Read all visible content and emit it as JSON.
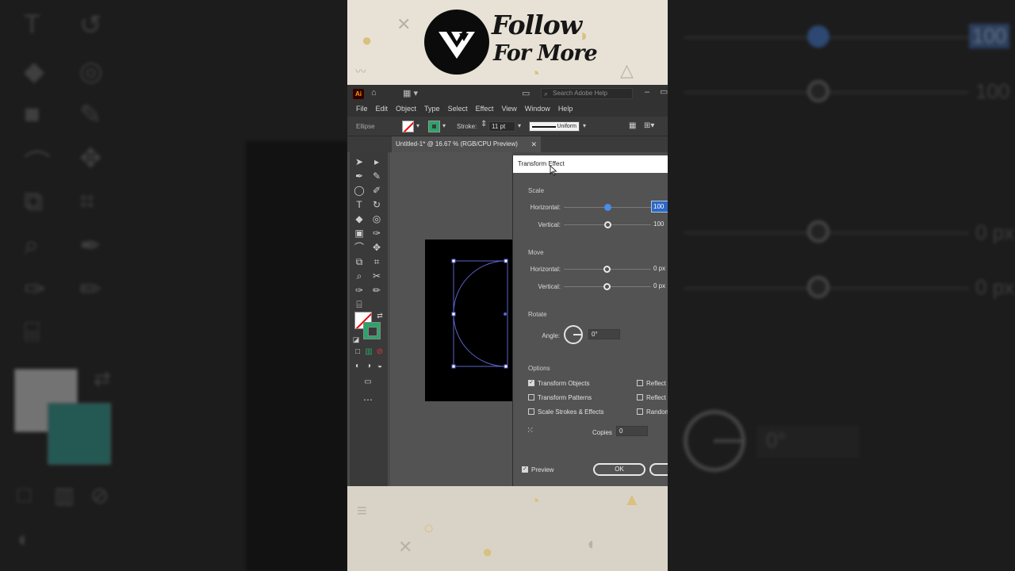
{
  "banner": {
    "follow": "Follow",
    "for_more": "For More"
  },
  "app": {
    "icon": "Ai",
    "search_placeholder": "Search Adobe Help",
    "menu": [
      "File",
      "Edit",
      "Object",
      "Type",
      "Select",
      "Effect",
      "View",
      "Window",
      "Help"
    ],
    "control_bar": {
      "object_type": "Ellipse",
      "stroke_label": "Stroke:",
      "stroke_weight": "11 pt",
      "profile": "Uniform"
    },
    "document_tab": "Untitled-1* @ 16.67 % (RGB/CPU Preview)"
  },
  "dialog": {
    "title": "Transform Effect",
    "scale": {
      "section": "Scale",
      "horizontal_label": "Horizontal:",
      "horizontal_value": "100",
      "horizontal_level": 0.5,
      "vertical_label": "Vertical:",
      "vertical_value": "100",
      "vertical_level": 0.5
    },
    "move": {
      "section": "Move",
      "horizontal_label": "Horizontal:",
      "horizontal_value": "0 px",
      "vertical_label": "Vertical:",
      "vertical_value": "0 px"
    },
    "rotate": {
      "section": "Rotate",
      "angle_label": "Angle:",
      "angle_value": "0°"
    },
    "options": {
      "section": "Options",
      "transform_objects": "Transform Objects",
      "transform_patterns": "Transform Patterns",
      "scale_strokes": "Scale Strokes & Effects",
      "reflect_x": "Reflect",
      "reflect_y": "Reflect",
      "random": "Random"
    },
    "copies_label": "Copies",
    "copies_value": "0",
    "preview_label": "Preview",
    "ok_label": "OK"
  },
  "background": {
    "right_values": [
      "100",
      "100",
      "0 px",
      "0 px",
      "0°"
    ]
  },
  "colors": {
    "accent": "#4b8de9",
    "selection": "#2d68c4",
    "path": "#5b63c9",
    "stroke_swatch": "#2aa46a"
  }
}
